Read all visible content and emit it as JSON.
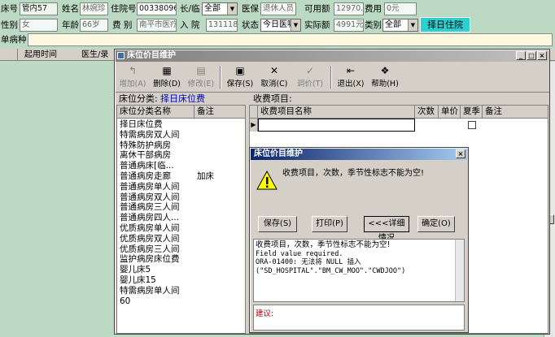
{
  "patient": {
    "bed_label": "床号",
    "bed_value": "管内57",
    "name_label": "姓名",
    "name_value": "林婉珍",
    "admit_label": "住院号",
    "admit_value": "00338096",
    "type_label": "长/临",
    "type_value": "全部",
    "insurance_label": "医保",
    "insurance_value": "退休人员",
    "balance_label": "可用额",
    "balance_value": "12970.8",
    "fee_label": "费用",
    "fee_value": "0元",
    "sex_label": "性别",
    "sex_value": "女",
    "age_label": "年龄",
    "age_value": "66岁",
    "ward_label": "费  别",
    "ward_value": "南平市医疗",
    "entry_label": "入  院",
    "entry_value": "131118",
    "status_label": "状态",
    "status_value": "今日医嘱",
    "real_label": "实际额",
    "real_value": "4991元",
    "category_label": "类别",
    "category_value": "全部",
    "select_btn": "择日住院",
    "order_label": "单病种"
  },
  "bg_grid": {
    "col1": "起用时间",
    "col2": "医生/录"
  },
  "main_window": {
    "title": "床位价目维护",
    "toolbar": [
      {
        "label": "增加(A)",
        "icon": "↰",
        "enabled": false
      },
      {
        "label": "删除(D)",
        "icon": "▦",
        "enabled": true
      },
      {
        "label": "修改(E)",
        "icon": "▤",
        "enabled": false
      },
      {
        "label": "保存(S)",
        "icon": "▣",
        "enabled": true
      },
      {
        "label": "取消(C)",
        "icon": "✕",
        "enabled": true
      },
      {
        "label": "调价(T)",
        "icon": "✓",
        "enabled": false
      },
      {
        "label": "退出(X)",
        "icon": "⇤",
        "enabled": true
      },
      {
        "label": "帮助(H)",
        "icon": "❖",
        "enabled": true
      }
    ],
    "category_label": "床位分类:",
    "category_value": "择日床位费",
    "fee_items_label": "收费项目:",
    "left_headers": [
      "床位分类名称",
      "备注"
    ],
    "right_headers": [
      "收费项目名称",
      "次数",
      "单价",
      "夏季",
      "备注"
    ],
    "categories": [
      {
        "name": "择日床位费",
        "note": ""
      },
      {
        "name": "特需病房双人间",
        "note": ""
      },
      {
        "name": "特殊防护病房",
        "note": ""
      },
      {
        "name": "离休干部病房",
        "note": ""
      },
      {
        "name": "普通病床[临...",
        "note": ""
      },
      {
        "name": "普通病房走廊",
        "note": "加床"
      },
      {
        "name": "普通病房单人间",
        "note": ""
      },
      {
        "name": "普通病房双人间",
        "note": ""
      },
      {
        "name": "普通病房三人间",
        "note": ""
      },
      {
        "name": "普通病房四人...",
        "note": ""
      },
      {
        "name": "优质病房单人间",
        "note": ""
      },
      {
        "name": "优质病房双人间",
        "note": ""
      },
      {
        "name": "优质病房三人间",
        "note": ""
      },
      {
        "name": "监护病房床位费",
        "note": ""
      },
      {
        "name": "婴儿床5",
        "note": ""
      },
      {
        "name": "婴儿床15",
        "note": ""
      },
      {
        "name": "特需病房单人间",
        "note": ""
      },
      {
        "name": "60",
        "note": ""
      }
    ]
  },
  "dialog": {
    "title": "床位价目维护",
    "message": "收费项目，次数，季节性标志不能为空!",
    "buttons": [
      "保存(S)",
      "打印(P)",
      "<<<详细情况",
      "确定(O)"
    ],
    "details": [
      "收费项目，次数，季节性标志不能为空!",
      "Field value required.",
      "ORA-01400: 无法将 NULL 插入",
      "(\"SD_HOSPITAL\".\"BM_CW_MOO\".\"CWDJOO\")"
    ],
    "suggest_label": "建议:"
  }
}
